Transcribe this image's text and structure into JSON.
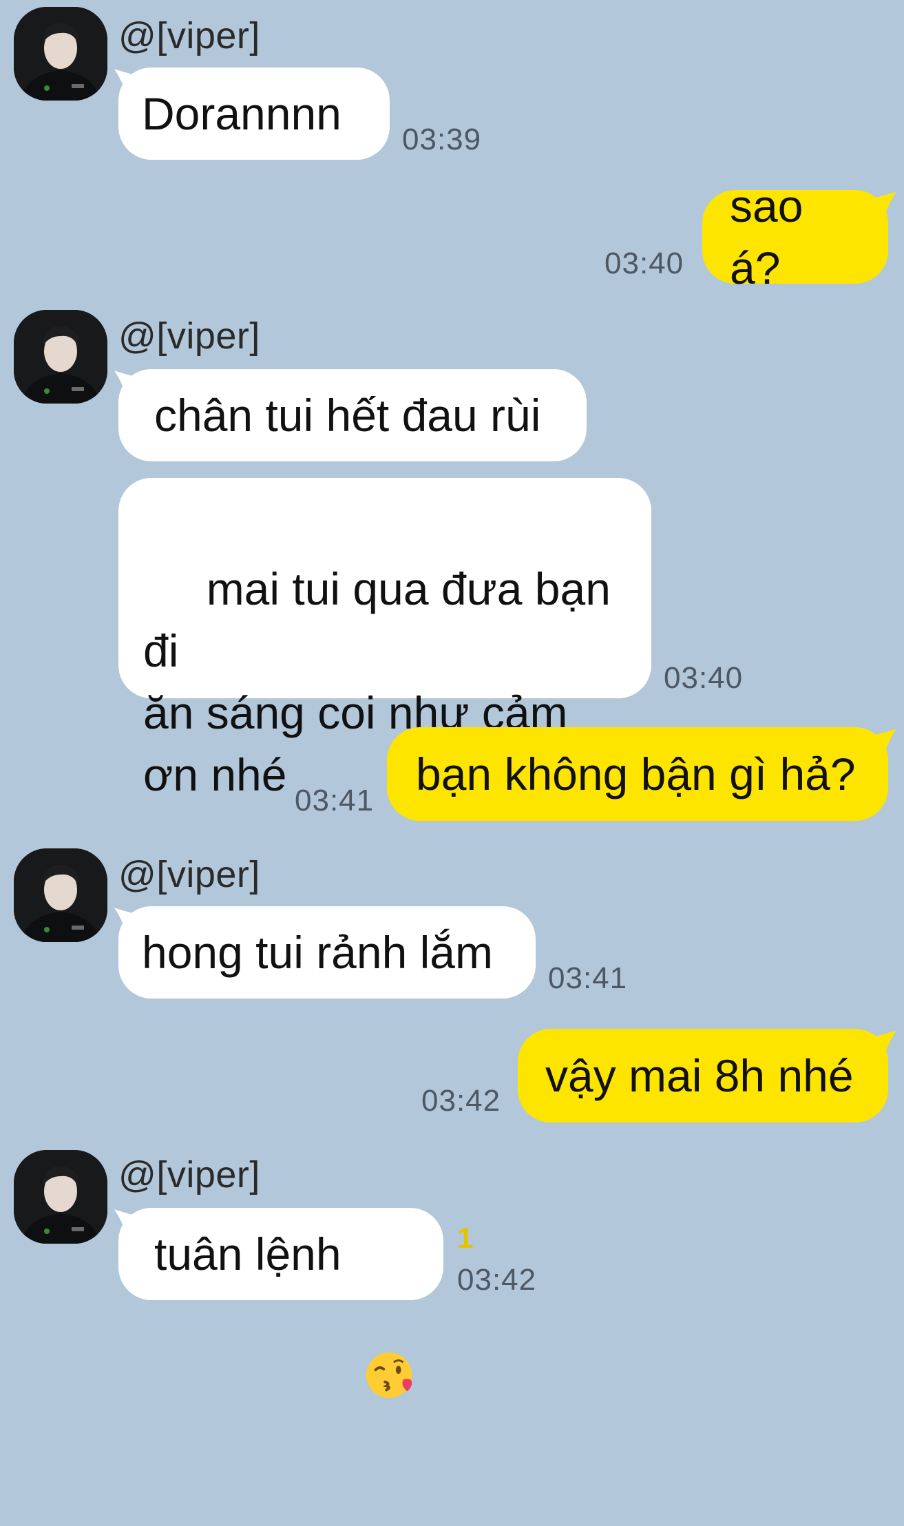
{
  "colors": {
    "background": "#b2c7d9",
    "incoming_bubble": "#ffffff",
    "outgoing_bubble": "#fee500",
    "unread_count": "#e3c400"
  },
  "messages": [
    {
      "sender": "@[viper]",
      "text": "Dorannnn",
      "time": "03:39"
    },
    {
      "text": "sao á?",
      "time": "03:40"
    },
    {
      "sender": "@[viper]",
      "text": "chân tui hết đau rùi"
    },
    {
      "text": " mai tui qua đưa bạn đi\năn sáng coi như cảm\nơn nhé",
      "time": "03:40"
    },
    {
      "text": "bạn không bận gì hả?",
      "time": "03:41"
    },
    {
      "sender": "@[viper]",
      "text": "hong tui rảnh lắm",
      "time": "03:41"
    },
    {
      "text": "vậy mai 8h nhé",
      "time": "03:42"
    },
    {
      "sender": "@[viper]",
      "text": "tuân lệnh ",
      "emoji": "face-blowing-a-kiss-emoji",
      "time": "03:42",
      "unread": "1"
    }
  ]
}
